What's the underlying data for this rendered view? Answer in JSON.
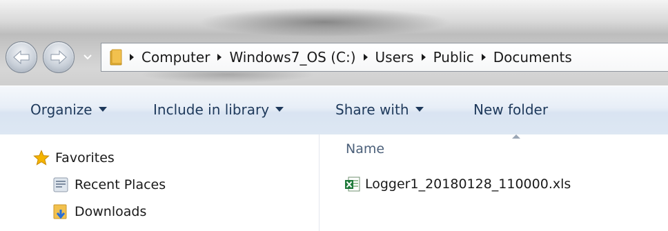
{
  "address_bar": {
    "breadcrumbs": [
      "Computer",
      "Windows7_OS (C:)",
      "Users",
      "Public",
      "Documents"
    ]
  },
  "toolbar": {
    "organize_label": "Organize",
    "include_library_label": "Include in library",
    "share_with_label": "Share with",
    "new_folder_label": "New folder"
  },
  "nav_pane": {
    "favorites_label": "Favorites",
    "items": [
      {
        "label": "Recent Places",
        "icon": "recent-places-icon"
      },
      {
        "label": "Downloads",
        "icon": "downloads-icon"
      }
    ]
  },
  "file_list": {
    "column_name_label": "Name",
    "files": [
      {
        "name": "Logger1_20180128_110000.xls",
        "icon": "excel-file-icon"
      }
    ]
  },
  "colors": {
    "toolbar_text": "#1e395b",
    "header_text": "#4c607a",
    "folder_yellow": "#f2c14e",
    "excel_green": "#1f7a3b"
  }
}
